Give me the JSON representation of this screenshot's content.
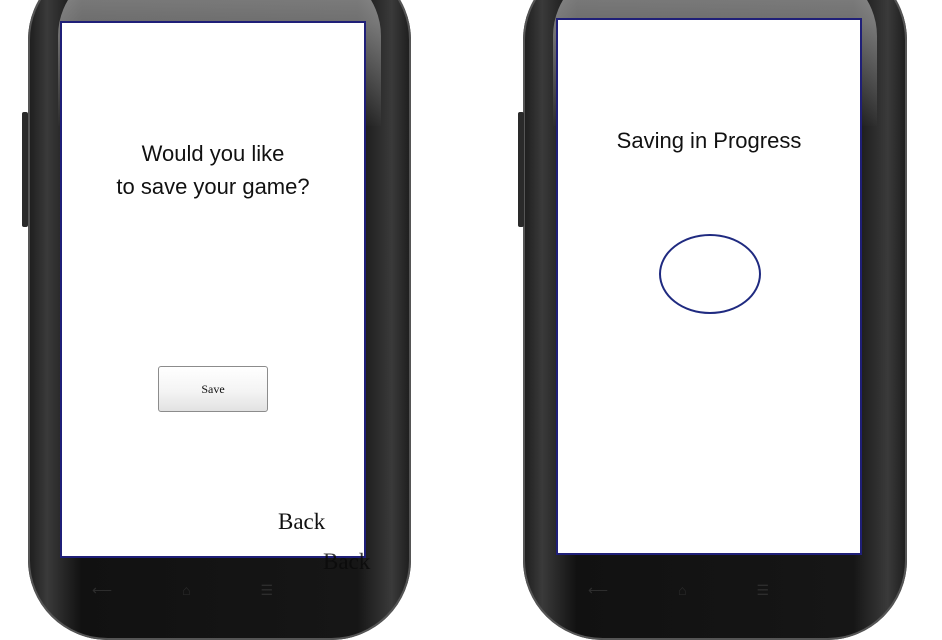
{
  "left_screen": {
    "prompt_line1": "Would you like",
    "prompt_line2": "to save your game?",
    "save_button_label": "Save",
    "back_label": "Back",
    "back_label_ghost": "Back"
  },
  "right_screen": {
    "status_text": "Saving in Progress"
  },
  "colors": {
    "screen_border": "#1f1f78",
    "spinner": "#1f2a80"
  },
  "icons": [
    "back-nav-icon",
    "home-nav-icon",
    "menu-nav-icon"
  ]
}
